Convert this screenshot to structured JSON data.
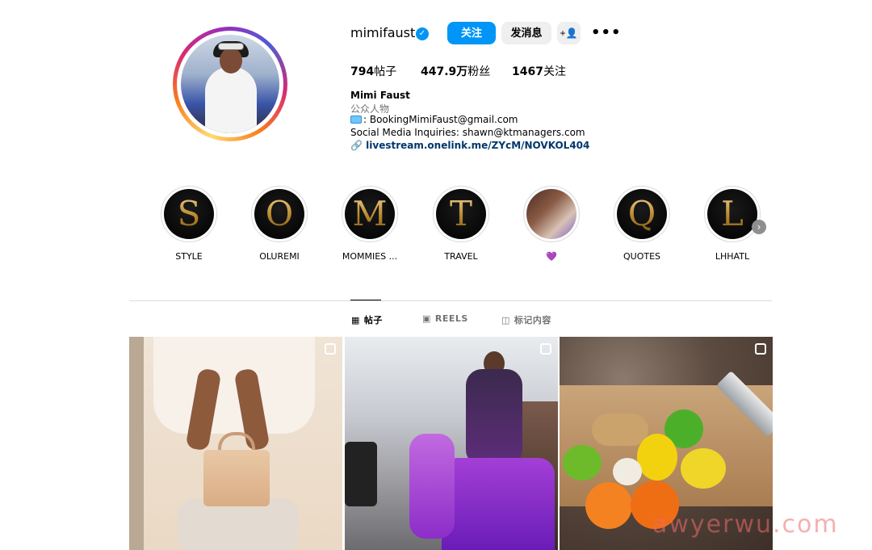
{
  "profile": {
    "username": "mimifaust",
    "follow_label": "关注",
    "message_label": "发消息",
    "suggest_label": "+&",
    "more_label": "•••"
  },
  "stats": {
    "posts_count": "794",
    "posts_label": "帖子",
    "followers_count": "447.9万",
    "followers_label": "粉丝",
    "following_count": "1467",
    "following_label": "关注"
  },
  "bio": {
    "name": "Mimi Faust",
    "category": "公众人物",
    "email_line": ": BookingMimiFaust@gmail.com",
    "inquiries_line": "Social Media Inquiries: shawn@ktmanagers.com",
    "link": "livestream.onelink.me/ZYcM/NOVKOL404"
  },
  "highlights": [
    {
      "letter": "S",
      "label": "STYLE"
    },
    {
      "letter": "O",
      "label": "OLUREMI"
    },
    {
      "letter": "M",
      "label": "MOMMIES ..."
    },
    {
      "letter": "T",
      "label": "TRAVEL"
    },
    {
      "letter": "",
      "label": "💜"
    },
    {
      "letter": "Q",
      "label": "QUOTES"
    },
    {
      "letter": "L",
      "label": "LHHATL"
    }
  ],
  "tabs": {
    "posts": "帖子",
    "reels": "REELS",
    "tagged": "标记内容"
  },
  "watermark": "awyerwu.com",
  "colors": {
    "accent": "#0095f6",
    "link": "#00376b",
    "highlight_gold": "#c9a14e"
  }
}
